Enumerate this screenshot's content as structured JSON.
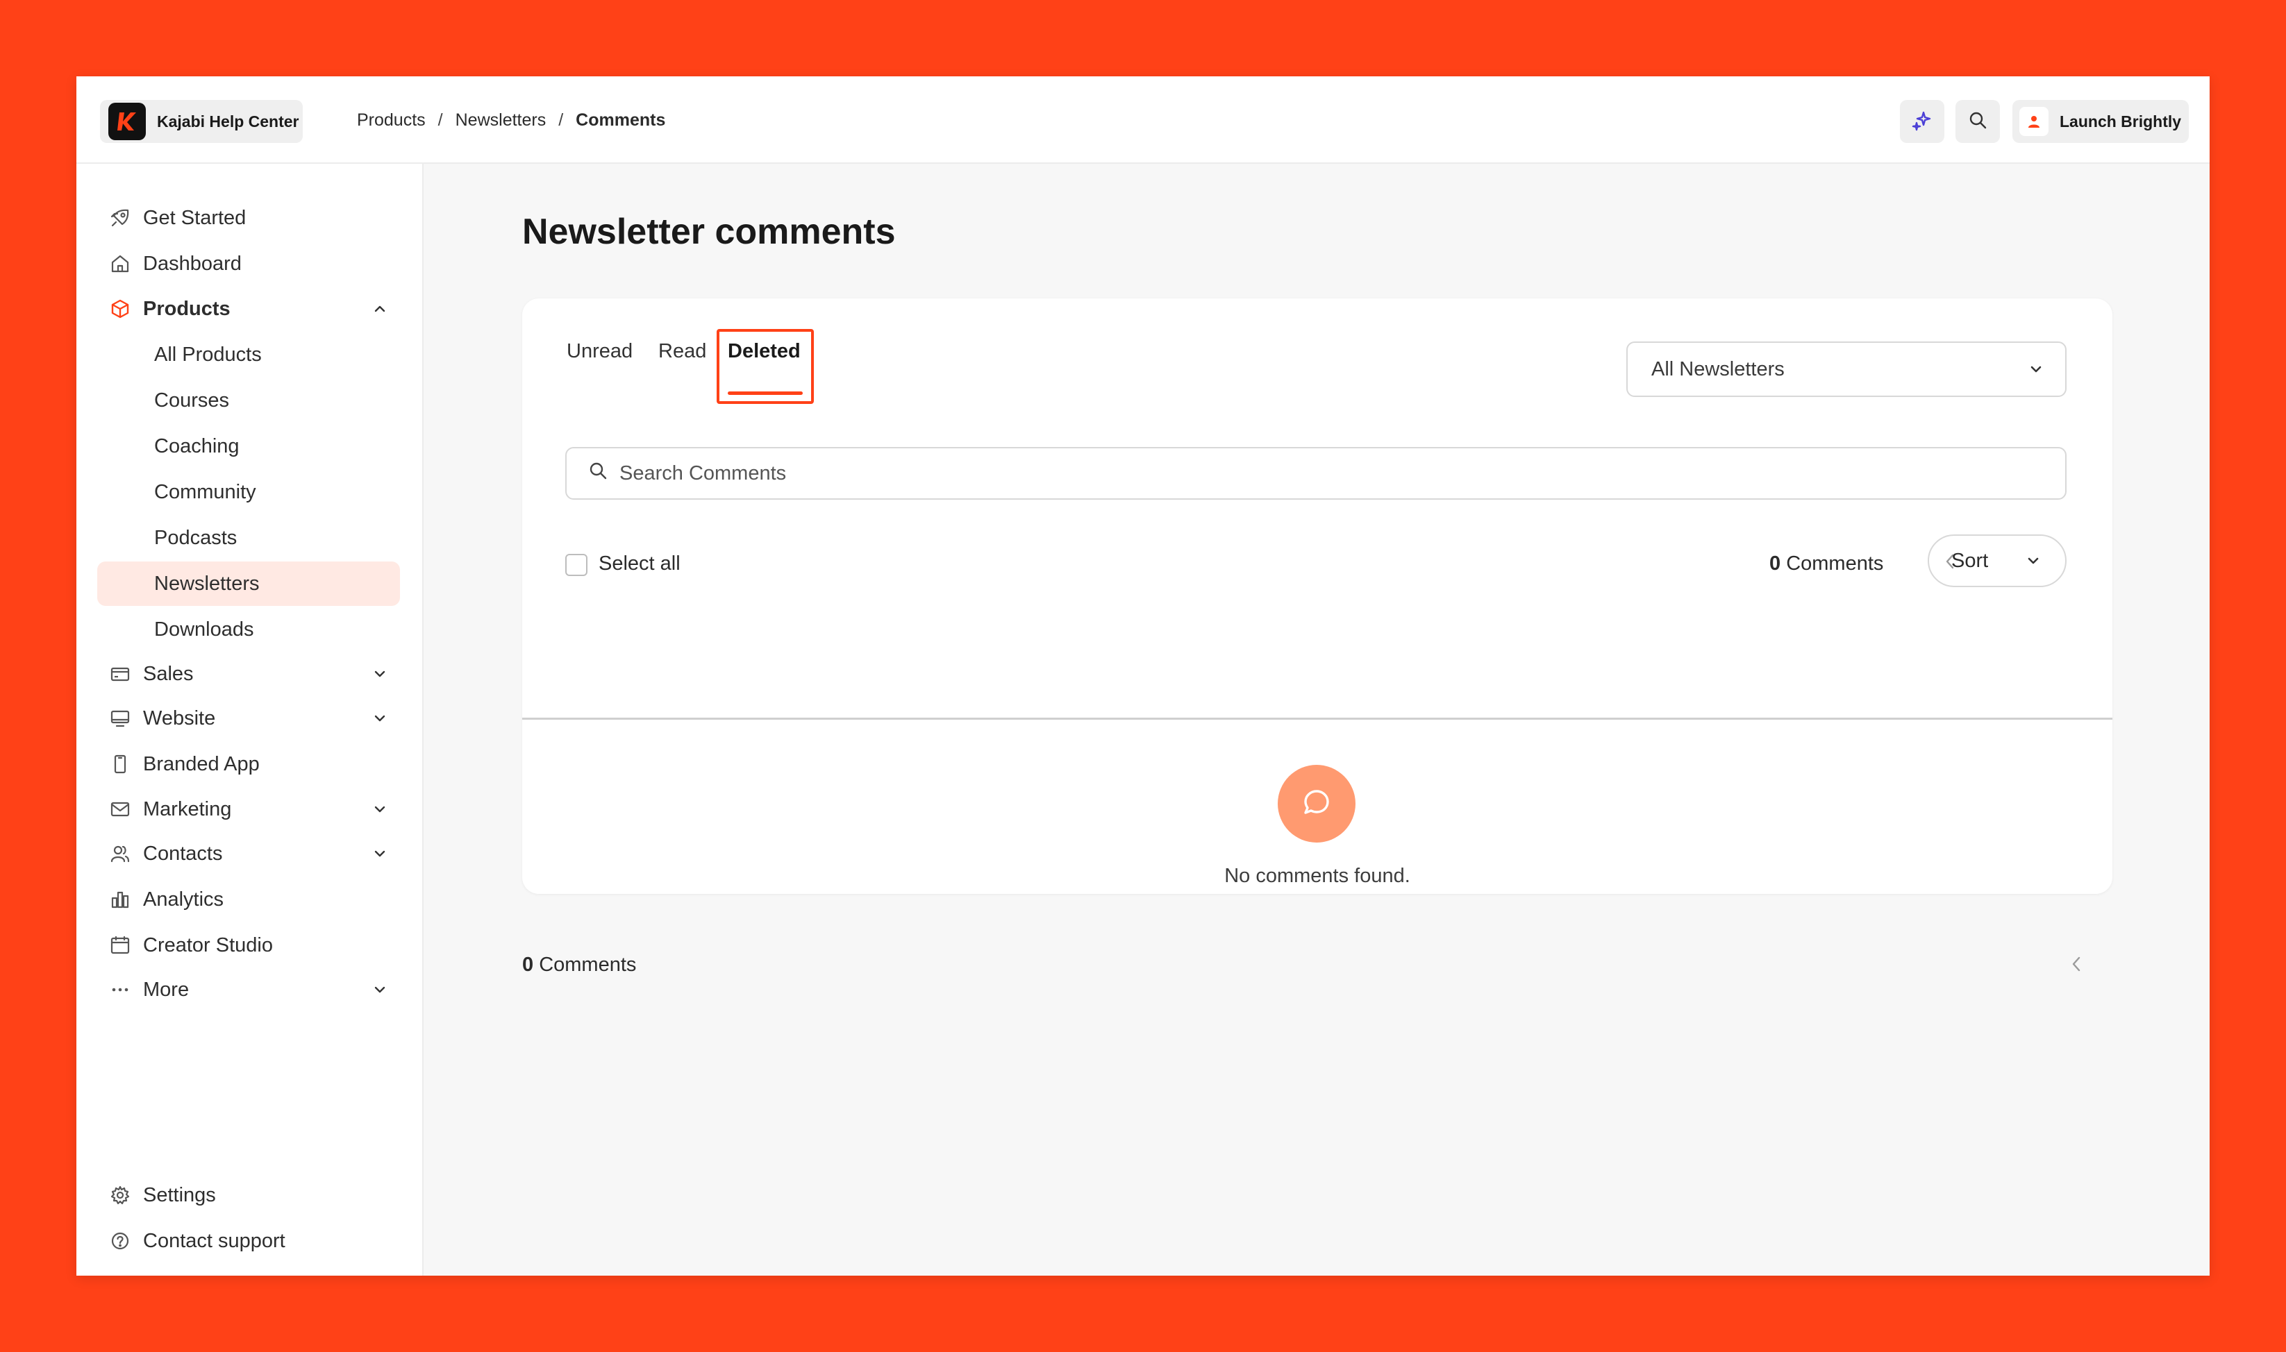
{
  "header": {
    "brand_name": "Kajabi Help Center",
    "breadcrumb": [
      "Products",
      "Newsletters",
      "Comments"
    ],
    "breadcrumb_separator": "/",
    "user_name": "Launch Brightly"
  },
  "sidebar": {
    "items": [
      {
        "label": "Get Started",
        "icon": "rocket-icon"
      },
      {
        "label": "Dashboard",
        "icon": "home-icon"
      },
      {
        "label": "Products",
        "icon": "box-icon",
        "expanded": true
      },
      {
        "label": "All Products"
      },
      {
        "label": "Courses"
      },
      {
        "label": "Coaching"
      },
      {
        "label": "Community"
      },
      {
        "label": "Podcasts"
      },
      {
        "label": "Newsletters",
        "active": true
      },
      {
        "label": "Downloads"
      },
      {
        "label": "Sales",
        "icon": "card-icon"
      },
      {
        "label": "Website",
        "icon": "monitor-icon"
      },
      {
        "label": "Branded App",
        "icon": "phone-icon"
      },
      {
        "label": "Marketing",
        "icon": "mail-icon"
      },
      {
        "label": "Contacts",
        "icon": "users-icon"
      },
      {
        "label": "Analytics",
        "icon": "bar-chart-icon"
      },
      {
        "label": "Creator Studio",
        "icon": "calendar-icon"
      },
      {
        "label": "More",
        "icon": "dots-icon"
      }
    ],
    "footer": [
      {
        "label": "Settings",
        "icon": "gear-icon"
      },
      {
        "label": "Contact support",
        "icon": "help-circle-icon"
      }
    ]
  },
  "main": {
    "title": "Newsletter comments",
    "tabs": [
      {
        "label": "Unread"
      },
      {
        "label": "Read"
      },
      {
        "label": "Deleted",
        "active": true
      }
    ],
    "newsletter_filter": "All Newsletters",
    "search_placeholder": "Search Comments",
    "select_all_label": "Select all",
    "count_number": "0",
    "count_label": "Comments",
    "sort_label": "Sort",
    "empty_message": "No comments found."
  },
  "colors": {
    "background": "#FF4117",
    "accent": "#FF4117",
    "active_nav_bg": "#FFE9E3",
    "empty_icon_bg": "#FF9A70"
  }
}
